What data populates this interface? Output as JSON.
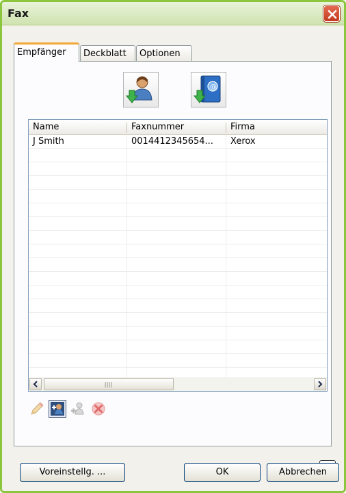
{
  "window": {
    "title": "Fax"
  },
  "tabs": [
    {
      "label": "Empfänger",
      "active": true
    },
    {
      "label": "Deckblatt",
      "active": false
    },
    {
      "label": "Optionen",
      "active": false
    }
  ],
  "toolbar_icons": [
    "add-from-address-book-icon",
    "add-from-email-directory-icon"
  ],
  "recipients": {
    "columns": [
      "Name",
      "Faxnummer",
      "Firma"
    ],
    "rows": [
      {
        "name": "J Smith",
        "fax": "0014412345654...",
        "company": "Xerox"
      }
    ]
  },
  "row_actions": [
    "edit-icon",
    "add-recipient-icon",
    "add-to-address-book-icon",
    "delete-icon"
  ],
  "help": {
    "label": "?"
  },
  "footer": {
    "defaults_label": "Voreinstellg. ...",
    "ok_label": "OK",
    "cancel_label": "Abbrechen"
  },
  "colors": {
    "accent_tab": "#f4a737",
    "frame": "#8cc63f",
    "close": "#c33a1f"
  }
}
